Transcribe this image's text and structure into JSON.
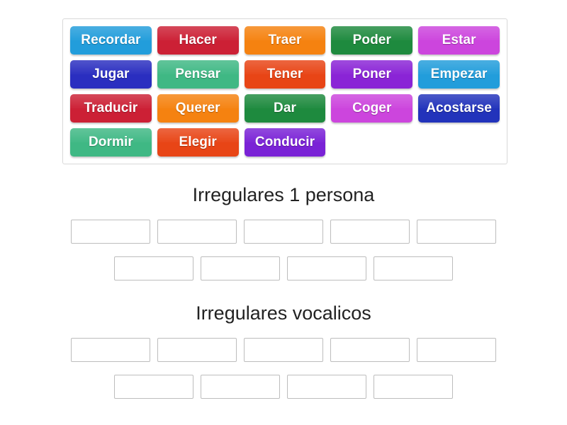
{
  "activity": {
    "type": "group-sort",
    "tile_pool": {
      "rows": [
        [
          {
            "label": "Recordar",
            "color": "#229ddb"
          },
          {
            "label": "Hacer",
            "color": "#cc2035"
          },
          {
            "label": "Traer",
            "color": "#f58210"
          },
          {
            "label": "Poder",
            "color": "#1e8a3e"
          },
          {
            "label": "Estar",
            "color": "#cc45dd"
          }
        ],
        [
          {
            "label": "Jugar",
            "color": "#2a2ec0"
          },
          {
            "label": "Pensar",
            "color": "#3fb884"
          },
          {
            "label": "Tener",
            "color": "#e84516"
          },
          {
            "label": "Poner",
            "color": "#8a24d6"
          },
          {
            "label": "Empezar",
            "color": "#229ddb"
          }
        ],
        [
          {
            "label": "Traducir",
            "color": "#cc2035"
          },
          {
            "label": "Querer",
            "color": "#f58210"
          },
          {
            "label": "Dar",
            "color": "#1e8a3e"
          },
          {
            "label": "Coger",
            "color": "#cc45dd"
          },
          {
            "label": "Acostarse",
            "color": "#2233bb"
          }
        ],
        [
          {
            "label": "Dormir",
            "color": "#3fb884"
          },
          {
            "label": "Elegir",
            "color": "#e84516"
          },
          {
            "label": "Conducir",
            "color": "#7a22d6"
          }
        ]
      ]
    },
    "groups": [
      {
        "title": "Irregulares 1 persona",
        "drop_rows": [
          [
            "",
            "",
            "",
            "",
            ""
          ],
          [
            "",
            "",
            "",
            ""
          ]
        ]
      },
      {
        "title": "Irregulares vocalicos",
        "drop_rows": [
          [
            "",
            "",
            "",
            "",
            ""
          ],
          [
            "",
            "",
            "",
            ""
          ]
        ]
      }
    ]
  }
}
